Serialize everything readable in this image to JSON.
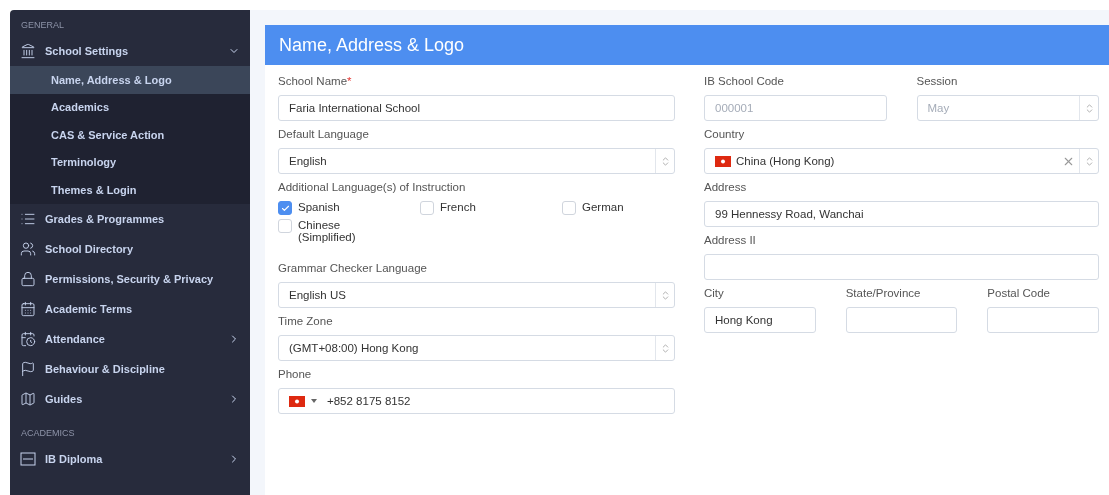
{
  "sidebar": {
    "sections": [
      {
        "heading": "GENERAL",
        "items": [
          {
            "label": "School Settings",
            "expanded": true,
            "children": [
              {
                "label": "Name, Address & Logo",
                "selected": true
              },
              {
                "label": "Academics",
                "selected": false
              },
              {
                "label": "CAS & Service Action",
                "selected": false
              },
              {
                "label": "Terminology",
                "selected": false
              },
              {
                "label": "Themes & Login",
                "selected": false
              }
            ]
          },
          {
            "label": "Grades & Programmes"
          },
          {
            "label": "School Directory"
          },
          {
            "label": "Permissions, Security & Privacy"
          },
          {
            "label": "Academic Terms"
          },
          {
            "label": "Attendance",
            "expanded": false
          },
          {
            "label": "Behaviour & Discipline"
          },
          {
            "label": "Guides",
            "expanded": false
          }
        ]
      },
      {
        "heading": "ACADEMICS",
        "items": [
          {
            "label": "IB Diploma",
            "expanded": false
          }
        ]
      }
    ]
  },
  "panel": {
    "title": "Name, Address & Logo",
    "left": [
      [
        {
          "kind": "text",
          "label": "School Name",
          "required_mark": "*",
          "value": "Faria International School"
        }
      ],
      [
        {
          "kind": "select",
          "label": "Default Language",
          "value": "English"
        }
      ],
      [
        {
          "kind": "checkboxes",
          "label": "Additional Language(s) of Instruction",
          "options": [
            {
              "label": "Spanish",
              "checked": true
            },
            {
              "label": "French",
              "checked": false
            },
            {
              "label": "German",
              "checked": false
            },
            {
              "label": "Chinese (Simplified)",
              "checked": false
            }
          ]
        }
      ],
      [
        {
          "kind": "select",
          "label": "Grammar Checker Language",
          "value": "English US"
        }
      ],
      [
        {
          "kind": "select",
          "label": "Time Zone",
          "value": "(GMT+08:00) Hong Kong"
        }
      ],
      [
        {
          "kind": "phone",
          "label": "Phone",
          "value": "+852 8175 8152"
        }
      ]
    ],
    "right": [
      [
        {
          "kind": "text",
          "label": "IB School Code",
          "value": "000001",
          "disabled": true
        },
        {
          "kind": "select",
          "label": "Session",
          "value": "May",
          "disabled": true
        }
      ],
      [
        {
          "kind": "country",
          "label": "Country",
          "value": "China (Hong Kong)"
        }
      ],
      [
        {
          "kind": "text",
          "label": "Address",
          "value": "99 Hennessy Road, Wanchai"
        }
      ],
      [
        {
          "kind": "text",
          "label": "Address II"
        }
      ],
      [
        {
          "kind": "text",
          "label": "City",
          "value": "Hong Kong"
        },
        {
          "kind": "text",
          "label": "State/Province"
        },
        {
          "kind": "text",
          "label": "Postal Code"
        }
      ]
    ]
  }
}
